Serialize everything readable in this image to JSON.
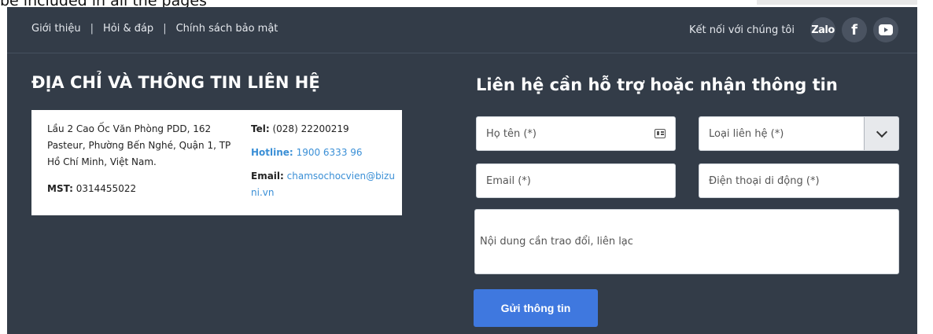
{
  "top_fragment": "be included in all the pages",
  "nav": {
    "links": [
      "Giới thiệu",
      "Hỏi & đáp",
      "Chính sách bảo mật"
    ],
    "separator": "|",
    "connect_label": "Kết nối với chúng tôi",
    "social": {
      "zalo": "Zalo",
      "facebook": "f"
    }
  },
  "left": {
    "title": "ĐỊA CHỈ VÀ THÔNG TIN LIÊN HỆ",
    "address": "Lầu 2 Cao Ốc Văn Phòng PDD, 162 Pasteur, Phường Bến Nghé, Quận 1, TP Hồ Chí Minh, Việt Nam.",
    "mst_label": "MST:",
    "mst_value": "0314455022",
    "tel_label": "Tel:",
    "tel_value": "(028) 22200219",
    "hotline_label": "Hotline:",
    "hotline_value": "1900 6333 96",
    "email_label": "Email:",
    "email_value": "chamsochocvien@bizuni.vn"
  },
  "form": {
    "title": "Liên hệ cần hỗ trợ hoặc nhận thông tin",
    "name_placeholder": "Họ tên (*)",
    "type_placeholder": "Loại liên hệ (*)",
    "email_placeholder": "Email (*)",
    "phone_placeholder": "Điện thoại di động (*)",
    "message_placeholder": "Nội dung cần trao đổi, liên lạc",
    "submit_label": "Gửi thông tin"
  },
  "colors": {
    "panel_bg": "#333c48",
    "accent": "#3f78df",
    "link_blue": "#3a8fd6"
  }
}
